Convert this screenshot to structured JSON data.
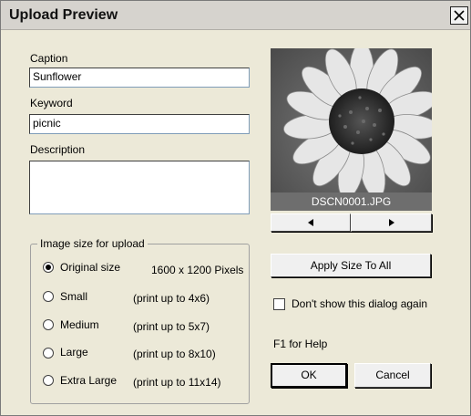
{
  "window": {
    "title": "Upload Preview"
  },
  "form": {
    "caption_label": "Caption",
    "caption_value": "Sunflower",
    "keyword_label": "Keyword",
    "keyword_value": "picnic",
    "description_label": "Description",
    "description_value": ""
  },
  "size_group": {
    "title": "Image size for upload",
    "options": [
      {
        "label": "Original size",
        "detail": "1600 x 1200 Pixels",
        "selected": true
      },
      {
        "label": "Small",
        "detail": "(print up to 4x6)",
        "selected": false
      },
      {
        "label": "Medium",
        "detail": "(print up to 5x7)",
        "selected": false
      },
      {
        "label": "Large",
        "detail": "(print up to 8x10)",
        "selected": false
      },
      {
        "label": "Extra Large",
        "detail": "(print up to 11x14)",
        "selected": false
      }
    ]
  },
  "preview": {
    "filename": "DSCN0001.JPG",
    "prev_icon": "left-triangle-icon",
    "next_icon": "right-triangle-icon"
  },
  "actions": {
    "apply_size_label": "Apply Size To All",
    "dont_show_label": "Don't show this dialog again",
    "dont_show_checked": false,
    "help_text": "F1 for Help",
    "ok_label": "OK",
    "cancel_label": "Cancel"
  }
}
